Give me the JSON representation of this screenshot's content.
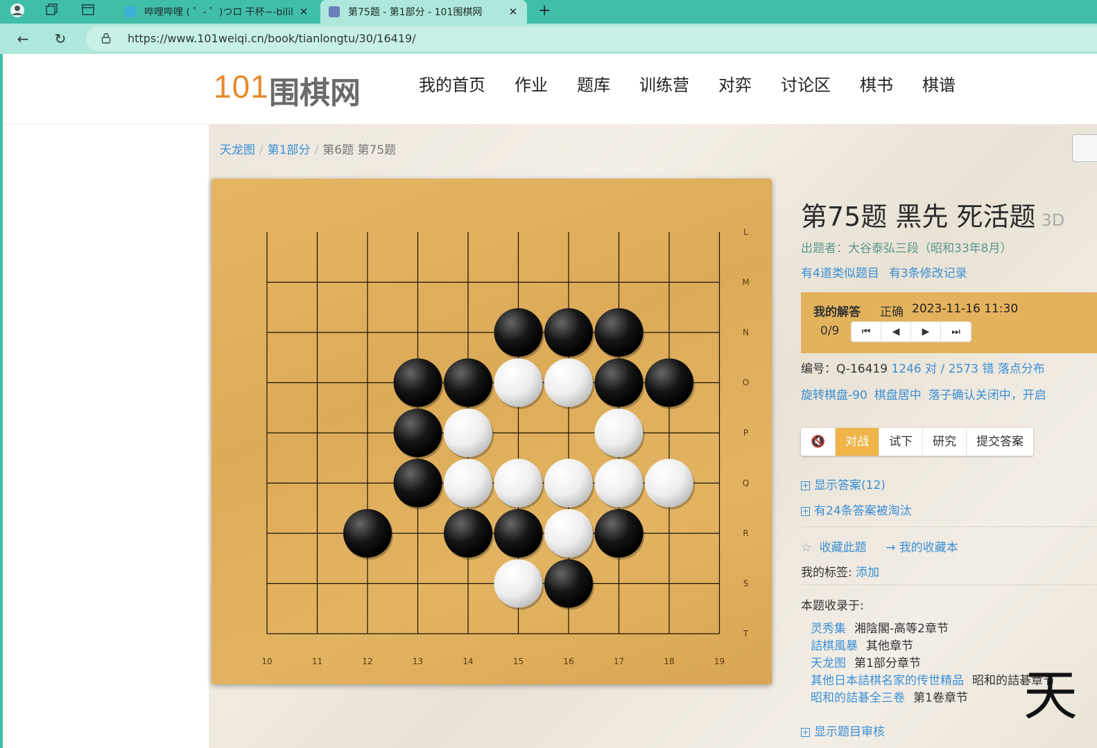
{
  "browser": {
    "tabs": [
      {
        "title": "哔哩哔哩 ( ゜- ゜)つロ 干杯~-bilil",
        "active": false
      },
      {
        "title": "第75题 - 第1部分 - 101围棋网",
        "active": true
      }
    ],
    "url": "https://www.101weiqi.cn/book/tianlongtu/30/16419/"
  },
  "site": {
    "logo_num": "101",
    "logo_text": "围棋网",
    "nav": [
      "我的首页",
      "作业",
      "题库",
      "训练营",
      "对弈",
      "讨论区",
      "棋书",
      "棋谱"
    ]
  },
  "breadcrumb": [
    "天龙图",
    "第1部分",
    "第6题 第75题"
  ],
  "board": {
    "col_labels": [
      "10",
      "11",
      "12",
      "13",
      "14",
      "15",
      "16",
      "17",
      "18",
      "19"
    ],
    "row_labels": [
      "L",
      "M",
      "N",
      "O",
      "P",
      "Q",
      "R",
      "S",
      "T"
    ],
    "stones": [
      {
        "c": "b",
        "col": "15",
        "row": "N"
      },
      {
        "c": "b",
        "col": "16",
        "row": "N"
      },
      {
        "c": "b",
        "col": "17",
        "row": "N"
      },
      {
        "c": "b",
        "col": "13",
        "row": "O"
      },
      {
        "c": "b",
        "col": "14",
        "row": "O"
      },
      {
        "c": "w",
        "col": "15",
        "row": "O"
      },
      {
        "c": "w",
        "col": "16",
        "row": "O"
      },
      {
        "c": "b",
        "col": "17",
        "row": "O"
      },
      {
        "c": "b",
        "col": "18",
        "row": "O"
      },
      {
        "c": "b",
        "col": "13",
        "row": "P"
      },
      {
        "c": "w",
        "col": "14",
        "row": "P"
      },
      {
        "c": "w",
        "col": "17",
        "row": "P"
      },
      {
        "c": "b",
        "col": "13",
        "row": "Q"
      },
      {
        "c": "w",
        "col": "14",
        "row": "Q"
      },
      {
        "c": "w",
        "col": "15",
        "row": "Q"
      },
      {
        "c": "w",
        "col": "16",
        "row": "Q"
      },
      {
        "c": "w",
        "col": "17",
        "row": "Q"
      },
      {
        "c": "w",
        "col": "18",
        "row": "Q"
      },
      {
        "c": "b",
        "col": "12",
        "row": "R"
      },
      {
        "c": "b",
        "col": "14",
        "row": "R"
      },
      {
        "c": "b",
        "col": "15",
        "row": "R"
      },
      {
        "c": "w",
        "col": "16",
        "row": "R"
      },
      {
        "c": "b",
        "col": "17",
        "row": "R"
      },
      {
        "c": "w",
        "col": "15",
        "row": "S"
      },
      {
        "c": "b",
        "col": "16",
        "row": "S"
      }
    ]
  },
  "problem": {
    "title": "第75题 黑先 死活题",
    "level": "3D",
    "author": "出题者：大谷泰弘三段（昭和33年8月）",
    "similar": "有4道类似题目",
    "revisions": "有3条修改记录",
    "answer_label": "我的解答",
    "answer_status": "正确",
    "answer_time": "2023-11-16 11:30",
    "answer_count": "0/9",
    "id_label": "编号：Q-16419",
    "stats": "1246 对 / 2573 错",
    "distribution": "落点分布",
    "options": [
      "旋转棋盘-90",
      "棋盘居中",
      "落子确认关闭中，开启"
    ],
    "modes": [
      "对战",
      "试下",
      "研究",
      "提交答案"
    ],
    "show_answers": "显示答案(12)",
    "eliminated": "有24条答案被淘汰",
    "favorite": "收藏此题",
    "my_favs": "→ 我的收藏本",
    "tags_label": "我的标签:",
    "tags_add": "添加",
    "included_label": "本题收录于:",
    "included": [
      {
        "book": "灵秀集",
        "chapter": "湘陰閣-高等2章节"
      },
      {
        "book": "詰棋風暴",
        "chapter": "其他章节"
      },
      {
        "book": "天龙图",
        "chapter": "第1部分章节"
      },
      {
        "book": "其他日本詰棋名家的传世精品",
        "chapter": "昭和的詰碁章节"
      },
      {
        "book": "昭和的詰碁全三卷",
        "chapter": "第1卷章节"
      }
    ],
    "show_review": "显示题目审核"
  },
  "overlay_char": "天"
}
